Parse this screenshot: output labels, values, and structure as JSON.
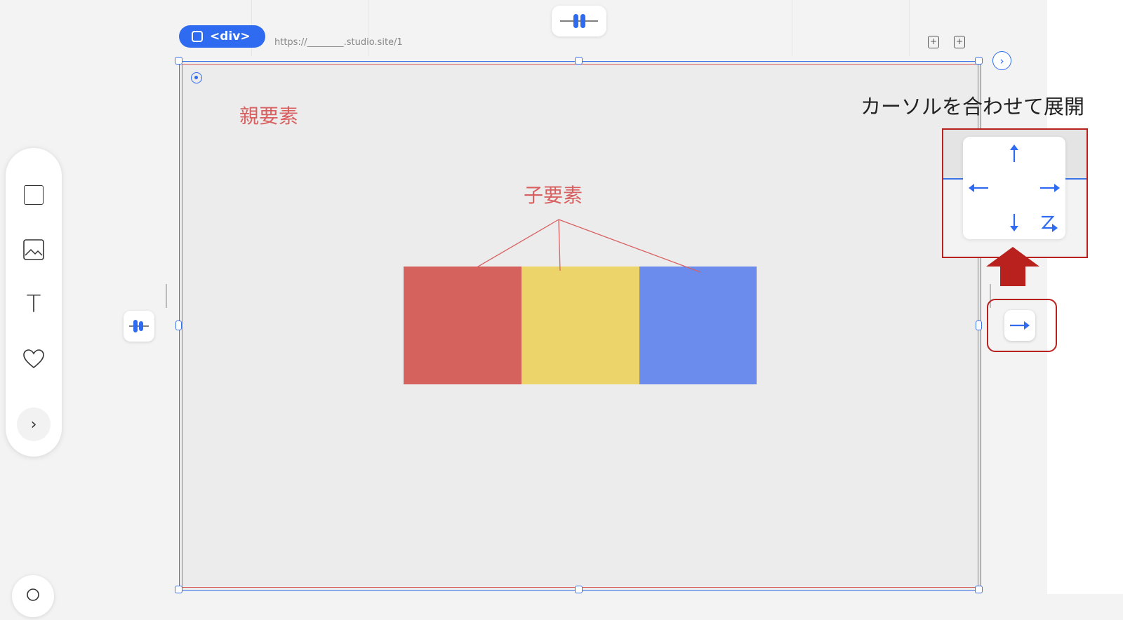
{
  "canvas": {
    "element_tag": "<div>",
    "url": "https://________.studio.site/1"
  },
  "annotations": {
    "parent_label": "親要素",
    "child_label": "子要素",
    "caption": "カーソルを合わせて展開"
  },
  "child_blocks": [
    {
      "name": "red-block",
      "color": "#d6625d"
    },
    {
      "name": "yellow-block",
      "color": "#edd46a"
    },
    {
      "name": "blue-block",
      "color": "#6b8ced"
    }
  ],
  "toolbar": {
    "items": [
      {
        "name": "box-tool",
        "icon": "square-icon"
      },
      {
        "name": "image-tool",
        "icon": "image-icon"
      },
      {
        "name": "text-tool",
        "icon": "text-icon",
        "glyph": "T"
      },
      {
        "name": "icon-tool",
        "icon": "heart-icon"
      }
    ],
    "more_glyph": "›"
  },
  "direction_popover": {
    "options": [
      "up",
      "left",
      "right",
      "down",
      "wrap"
    ]
  },
  "colors": {
    "accent": "#2f6bf0",
    "annotation": "#d86060",
    "highlight_box": "#b8211e"
  }
}
